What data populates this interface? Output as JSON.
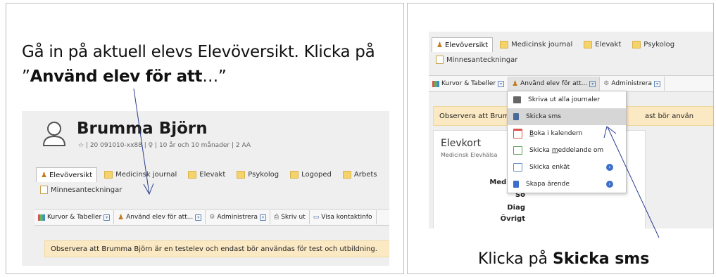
{
  "left": {
    "caption": {
      "pre": "Gå in på aktuell elevs Elevöversikt. Klicka på ”",
      "bold": "Använd elev för att",
      "post": "…”"
    },
    "student": {
      "name": "Brumma Björn",
      "info": "☆ | 20 091010-xx88 | ♀ | 10 år och 10 månader | 2 AA"
    },
    "tabs": [
      "Elevöversikt",
      "Medicinsk journal",
      "Elevakt",
      "Psykolog",
      "Logoped",
      "Arbets"
    ],
    "tab_row2": "Minnesanteckningar",
    "toolbar": [
      "Kurvor & Tabeller",
      "Använd elev för att...",
      "Administrera",
      "Skriv ut",
      "Visa kontaktinfo"
    ],
    "notice": "Observera att Brumma Björn är en testelev och endast bör användas för test och utbildning."
  },
  "right": {
    "caption": {
      "pre": "Klicka på ",
      "bold": "Skicka sms"
    },
    "tabs": [
      "Elevöversikt",
      "Medicinsk journal",
      "Elevakt",
      "Psykolog"
    ],
    "tab_row2": "Minnesanteckningar",
    "toolbar": [
      "Kurvor & Tabeller",
      "Använd elev för att...",
      "Administrera"
    ],
    "notice_left": "Observera att Brum",
    "notice_right": "ast bör använ",
    "menu": [
      {
        "label": "Skriva ut alla journaler",
        "icon": "printer-icon",
        "color": "#555555"
      },
      {
        "label": "Skicka sms",
        "icon": "phone-icon",
        "color": "#4a6a9a"
      },
      {
        "label": "Boka i kalendern",
        "icon": "calendar-icon",
        "color": "#d9534f"
      },
      {
        "label": "Skicka meddelande om",
        "icon": "mail-icon",
        "color": "#5aa05a"
      },
      {
        "label": "Skicka enkät",
        "icon": "mail-icon",
        "color": "#6b8fc4"
      },
      {
        "label": "Skapa ärende",
        "icon": "book-icon",
        "color": "#3b6fc9"
      }
    ],
    "card": {
      "title": "Elevkort",
      "subtitle": "Medicinsk Elevhälsa",
      "fields": [
        "Medicine",
        "So",
        "Diag",
        "Övrigt"
      ]
    }
  },
  "colors": {
    "notice_bg": "#fbe9c4",
    "menu_selected": "#d6d6d6",
    "accent_blue": "#3b6fc9"
  }
}
